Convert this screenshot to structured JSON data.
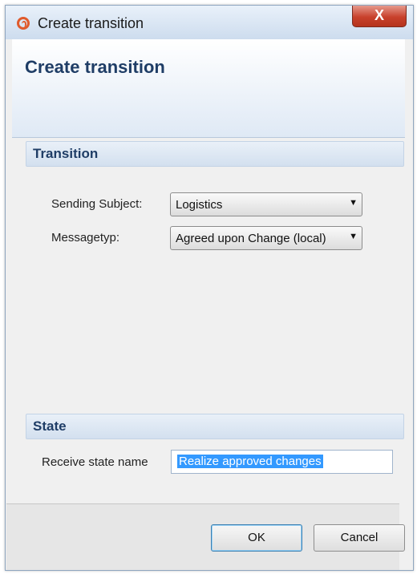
{
  "window": {
    "title": "Create transition",
    "close_label": "X"
  },
  "header": {
    "title": "Create transition"
  },
  "transition_section": {
    "title": "Transition",
    "sending_subject_label": "Sending Subject:",
    "sending_subject_value": "Logistics",
    "messagetype_label": "Messagetyp:",
    "messagetype_value": "Agreed upon Change (local)"
  },
  "state_section": {
    "title": "State",
    "receive_state_label": "Receive state name",
    "receive_state_value": "Realize approved changes"
  },
  "footer": {
    "ok_label": "OK",
    "cancel_label": "Cancel"
  },
  "icons": {
    "app": "app-logo-icon",
    "dropdown": "chevron-down-icon"
  }
}
